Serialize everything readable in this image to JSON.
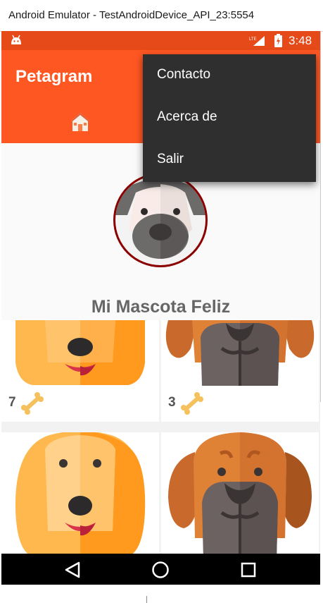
{
  "window": {
    "title": "Android Emulator - TestAndroidDevice_API_23:5554"
  },
  "status_bar": {
    "network": "LTE",
    "time": "3:48",
    "color": "#e64a19",
    "icons": [
      "android-icon",
      "signal-icon",
      "battery-icon"
    ]
  },
  "app_bar": {
    "title": "Petagram",
    "color": "#ff5722",
    "tab_icon": "home-icon"
  },
  "overflow_menu": {
    "items": [
      {
        "label": "Contacto"
      },
      {
        "label": "Acerca de"
      },
      {
        "label": "Salir"
      }
    ]
  },
  "profile": {
    "pet_name": "Mi Mascota Feliz",
    "avatar_icon": "husky-avatar"
  },
  "grid": {
    "cards": [
      {
        "likes": "7",
        "dog": "golden-retriever"
      },
      {
        "likes": "3",
        "dog": "boxer"
      },
      {
        "likes": "",
        "dog": "golden-retriever"
      },
      {
        "likes": "",
        "dog": "boxer"
      }
    ]
  },
  "nav_bar": {
    "buttons": [
      "back",
      "home",
      "recents"
    ]
  }
}
